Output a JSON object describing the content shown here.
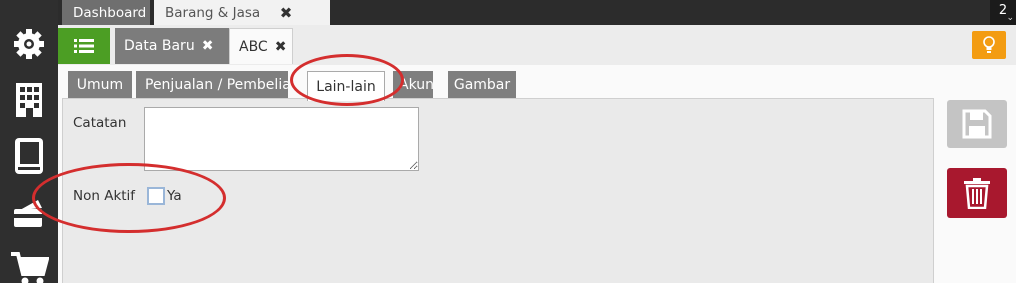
{
  "top_tabs": [
    {
      "label": "Dashboard"
    },
    {
      "label": "Barang & Jasa"
    }
  ],
  "top_close_glyph": "✖",
  "top_counter": "2",
  "doc_tabs": [
    {
      "label": "Data Baru",
      "close": "✖"
    },
    {
      "label": "ABC",
      "close": "✖"
    }
  ],
  "sub_tabs": [
    {
      "label": "Umum"
    },
    {
      "label": "Penjualan / Pembelian"
    },
    {
      "label": "Lain-lain"
    },
    {
      "label": "Akun"
    },
    {
      "label": "Gambar"
    }
  ],
  "form": {
    "catatan_label": "Catatan",
    "catatan_value": "",
    "non_aktif_label": "Non Aktif",
    "non_aktif_option": "Ya",
    "non_aktif_checked": false
  },
  "sidebar_icons": [
    "gear-icon",
    "building-icon",
    "book-icon",
    "card-icon",
    "cart-icon"
  ],
  "colors": {
    "green": "#4c9e24",
    "orange": "#f39c12",
    "delete_red": "#a8182e",
    "annotation_red": "#d42e2e",
    "sidebar_dark": "#2f2f2f"
  }
}
